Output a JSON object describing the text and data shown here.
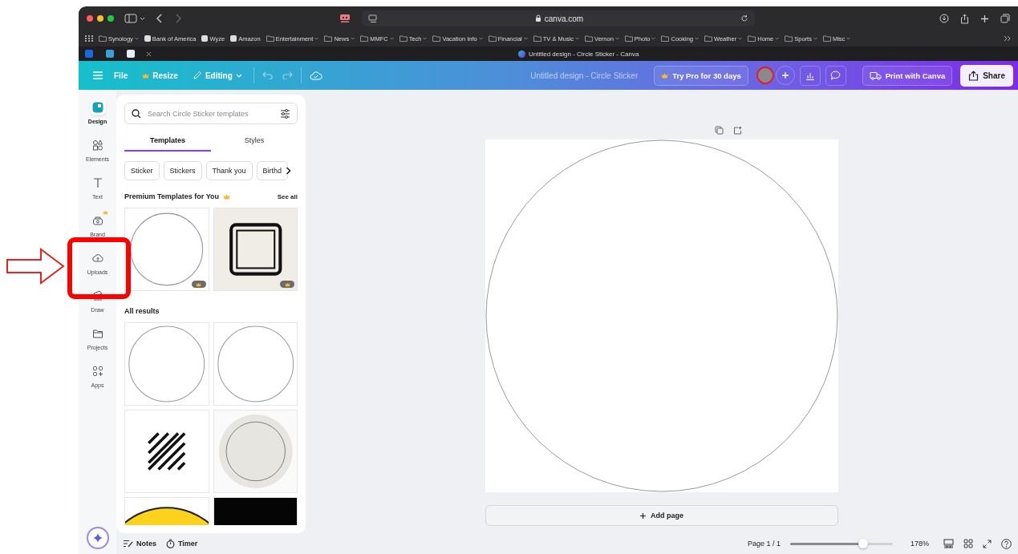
{
  "browser": {
    "url": "canva.com",
    "tab_title": "Untitled design - Circle Sticker - Canva",
    "bookmarks": [
      {
        "label": "Synology",
        "kind": "folder"
      },
      {
        "label": "Bank of America",
        "kind": "site"
      },
      {
        "label": "Wyze",
        "kind": "site"
      },
      {
        "label": "Amazon",
        "kind": "site"
      },
      {
        "label": "Entertainment",
        "kind": "folder"
      },
      {
        "label": "News",
        "kind": "folder"
      },
      {
        "label": "MMFC",
        "kind": "folder"
      },
      {
        "label": "Tech",
        "kind": "folder"
      },
      {
        "label": "Vacation Info",
        "kind": "folder"
      },
      {
        "label": "Financial",
        "kind": "folder"
      },
      {
        "label": "TV & Music",
        "kind": "folder"
      },
      {
        "label": "Vernon",
        "kind": "folder"
      },
      {
        "label": "Photo",
        "kind": "folder"
      },
      {
        "label": "Cooking",
        "kind": "folder"
      },
      {
        "label": "Weather",
        "kind": "folder"
      },
      {
        "label": "Home",
        "kind": "folder"
      },
      {
        "label": "Sports",
        "kind": "folder"
      },
      {
        "label": "Misc",
        "kind": "folder"
      }
    ]
  },
  "header": {
    "menu": [
      {
        "label": "File",
        "kind": "plain"
      },
      {
        "label": "Resize",
        "kind": "crown"
      },
      {
        "label": "Editing",
        "kind": "dropdown"
      }
    ],
    "design_title": "Untitled design - Circle Sticker",
    "try_pro": "Try Pro for 30 days",
    "print": "Print with Canva",
    "share": "Share"
  },
  "sidebar": {
    "items": [
      {
        "label": "Design",
        "selected": true
      },
      {
        "label": "Elements",
        "selected": false
      },
      {
        "label": "Text",
        "selected": false
      },
      {
        "label": "Brand",
        "selected": false
      },
      {
        "label": "Uploads",
        "selected": false,
        "highlighted": true
      },
      {
        "label": "Draw",
        "selected": false
      },
      {
        "label": "Projects",
        "selected": false
      },
      {
        "label": "Apps",
        "selected": false
      }
    ]
  },
  "panel": {
    "search": {
      "placeholder": "Search Circle Sticker templates"
    },
    "tabs": [
      {
        "label": "Templates",
        "selected": true
      },
      {
        "label": "Styles",
        "selected": false
      }
    ],
    "chips": [
      "Sticker",
      "Stickers",
      "Thank you",
      "Birthd"
    ],
    "premium_heading": "Premium Templates for You",
    "see_all": "See all",
    "premium_templates": [
      {
        "kind": "circle",
        "premium": true
      },
      {
        "kind": "frame",
        "premium": true
      }
    ],
    "results_heading": "All results",
    "results": [
      {
        "kind": "circle"
      },
      {
        "kind": "circle"
      },
      {
        "kind": "stripes"
      },
      {
        "kind": "beige"
      },
      {
        "kind": "yellow"
      },
      {
        "kind": "dark"
      }
    ]
  },
  "canvas": {
    "add_page": "Add page"
  },
  "footer": {
    "notes": "Notes",
    "timer": "Timer",
    "page": "Page 1 / 1",
    "zoom": {
      "level": 0.71,
      "reading": "178%"
    }
  }
}
